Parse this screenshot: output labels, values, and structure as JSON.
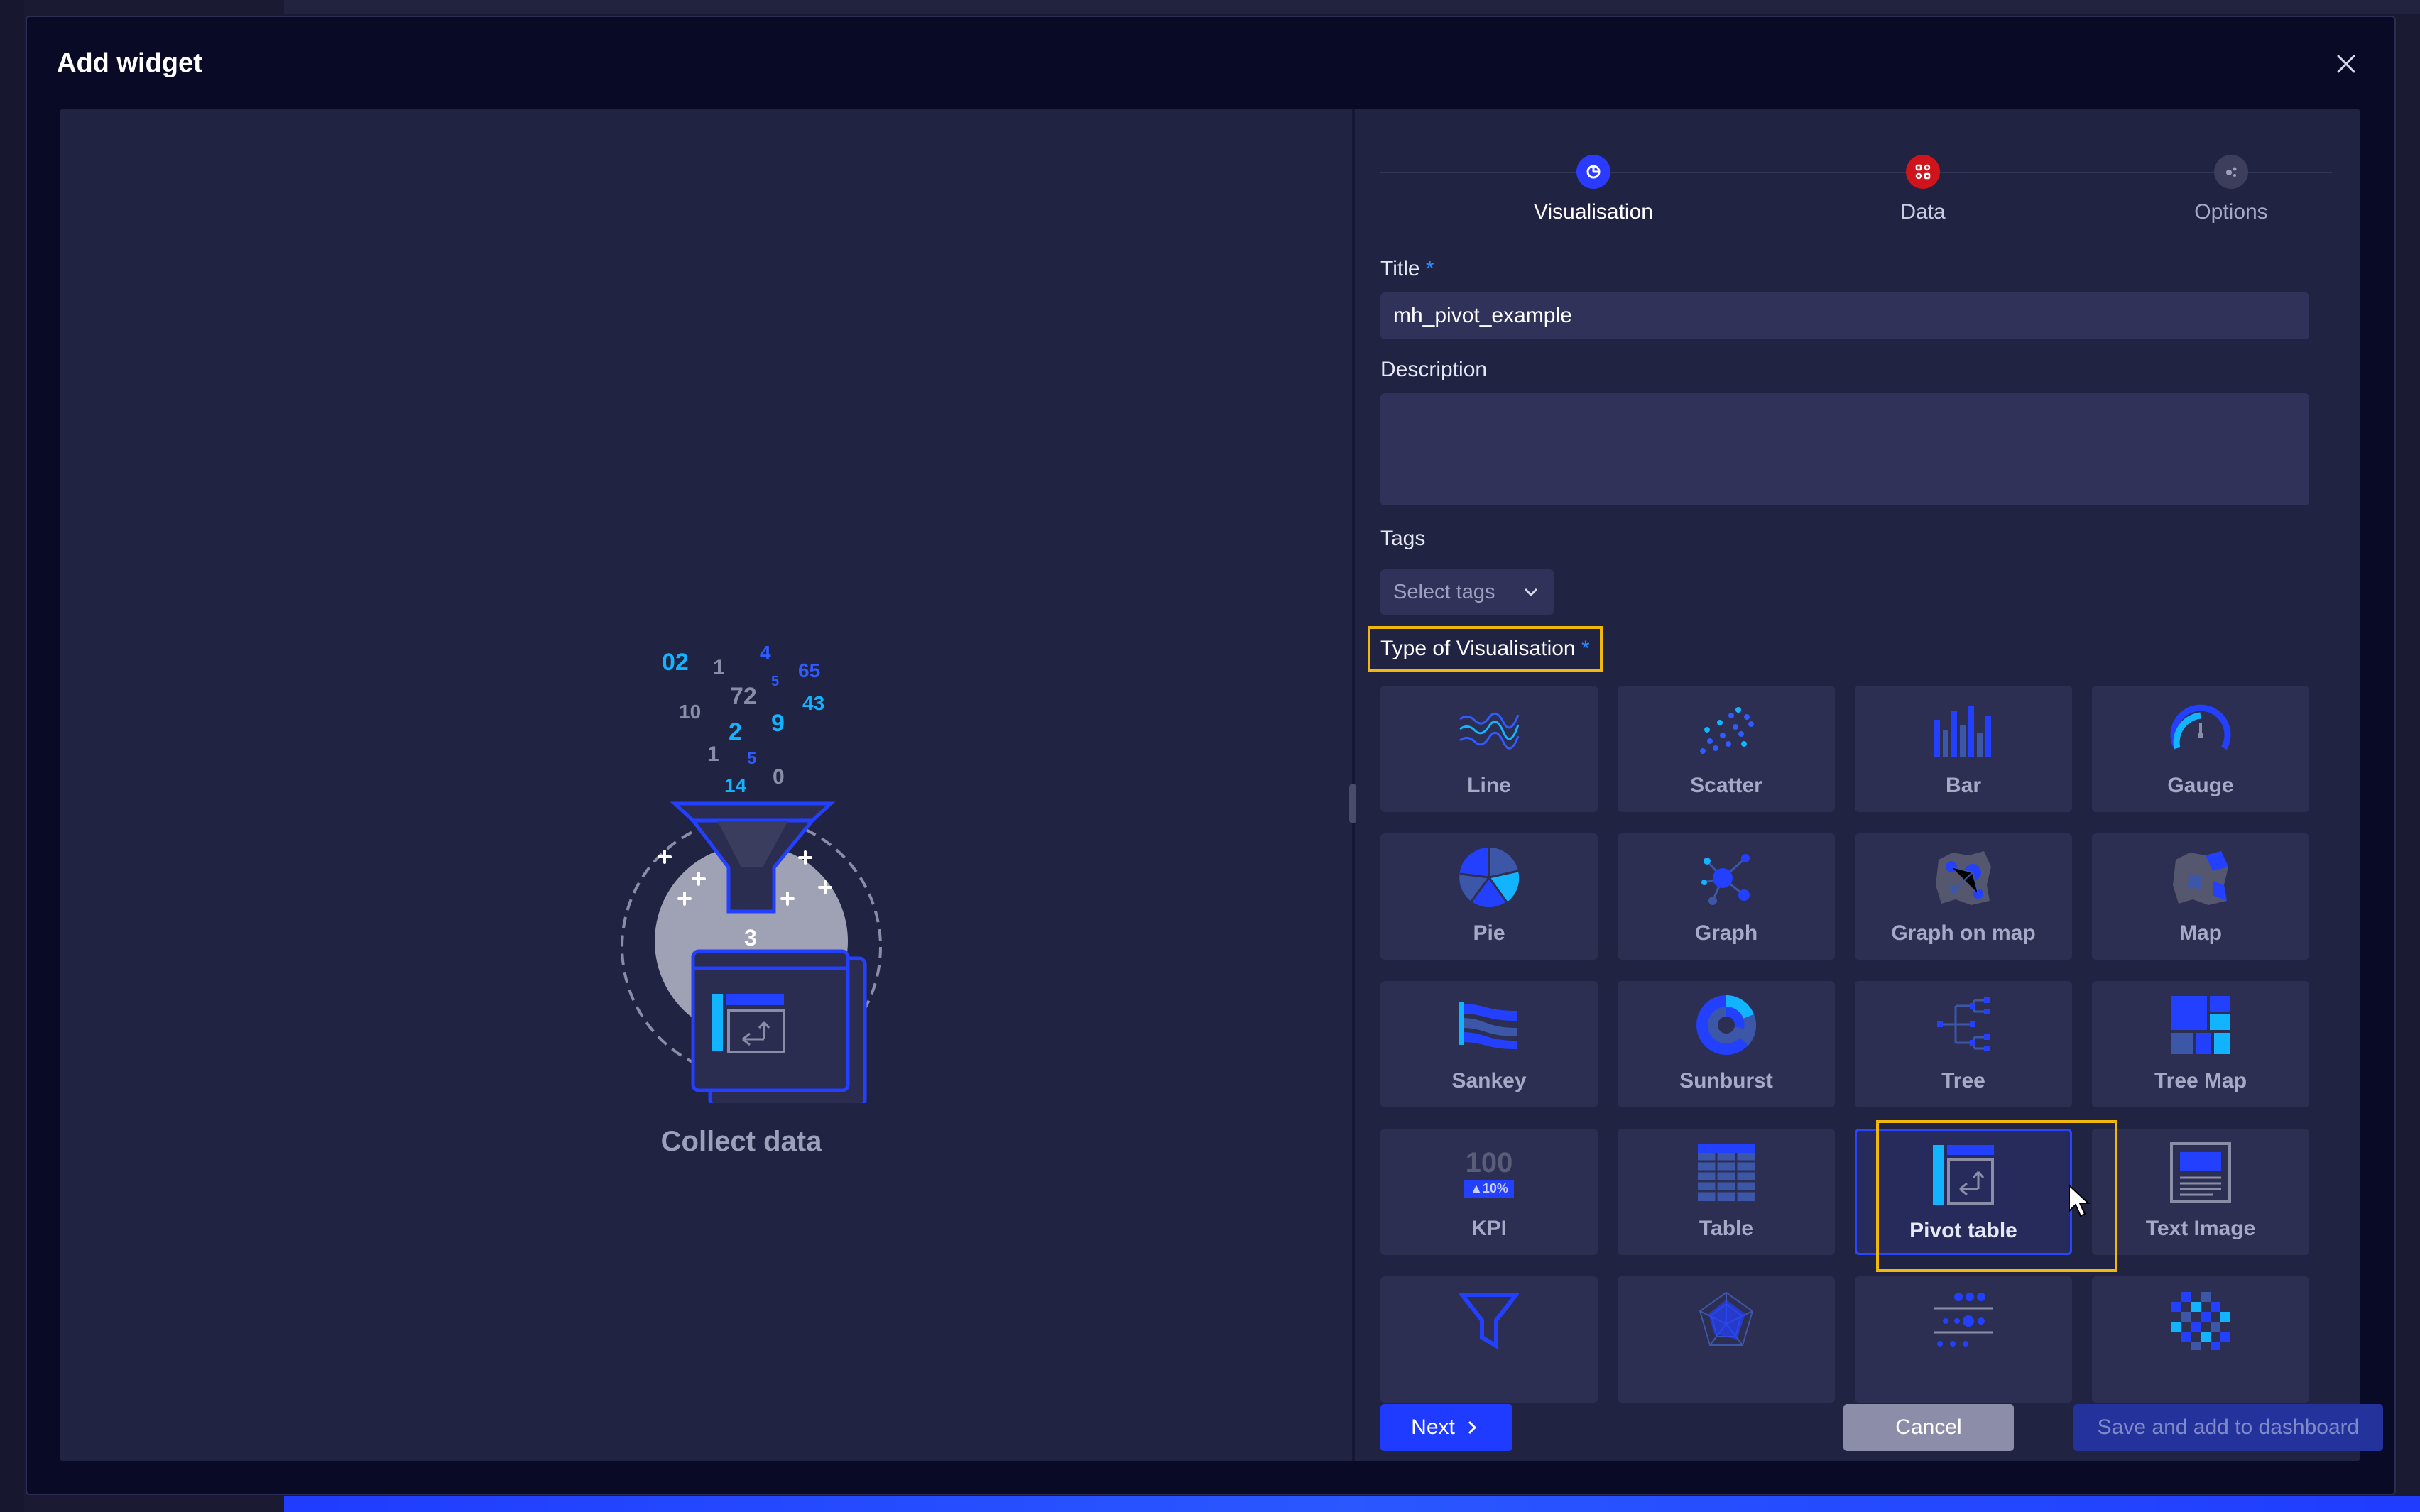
{
  "dialog": {
    "title": "Add widget"
  },
  "illustration": {
    "label": "Collect data",
    "numbers": [
      "02",
      "1",
      "4",
      "65",
      "10",
      "72",
      "5",
      "43",
      "2",
      "9",
      "1",
      "5",
      "14",
      "0",
      "3"
    ]
  },
  "stepper": {
    "steps": [
      {
        "label": "Visualisation",
        "icon": "chart-icon",
        "color": "#2a3bff",
        "active": true
      },
      {
        "label": "Data",
        "icon": "data-icon",
        "color": "#d0141c",
        "active": false
      },
      {
        "label": "Options",
        "icon": "options-icon",
        "color": "#3c3e5c",
        "active": false
      }
    ]
  },
  "form": {
    "title_label": "Title",
    "title_value": "mh_pivot_example",
    "description_label": "Description",
    "description_value": "",
    "tags_label": "Tags",
    "tags_placeholder": "Select tags",
    "type_label": "Type of Visualisation",
    "required_mark": "*"
  },
  "visualisations": [
    {
      "label": "Line",
      "icon": "line-chart-icon"
    },
    {
      "label": "Scatter",
      "icon": "scatter-chart-icon"
    },
    {
      "label": "Bar",
      "icon": "bar-chart-icon"
    },
    {
      "label": "Gauge",
      "icon": "gauge-icon"
    },
    {
      "label": "Pie",
      "icon": "pie-chart-icon"
    },
    {
      "label": "Graph",
      "icon": "graph-icon"
    },
    {
      "label": "Graph on map",
      "icon": "graph-on-map-icon"
    },
    {
      "label": "Map",
      "icon": "map-icon"
    },
    {
      "label": "Sankey",
      "icon": "sankey-icon"
    },
    {
      "label": "Sunburst",
      "icon": "sunburst-icon"
    },
    {
      "label": "Tree",
      "icon": "tree-icon"
    },
    {
      "label": "Tree Map",
      "icon": "tree-map-icon"
    },
    {
      "label": "KPI",
      "icon": "kpi-icon",
      "kpi_value": "100",
      "kpi_delta": "▲10%"
    },
    {
      "label": "Table",
      "icon": "table-icon"
    },
    {
      "label": "Pivot table",
      "icon": "pivot-table-icon",
      "selected": true
    },
    {
      "label": "Text Image",
      "icon": "text-image-icon"
    },
    {
      "label": "",
      "icon": "funnel-icon"
    },
    {
      "label": "",
      "icon": "radar-icon"
    },
    {
      "label": "",
      "icon": "dot-plot-icon"
    },
    {
      "label": "",
      "icon": "heatmap-icon"
    }
  ],
  "actions": {
    "next": "Next",
    "cancel": "Cancel",
    "save": "Save and add to dashboard"
  },
  "colors": {
    "accent": "#1e3bff",
    "highlight": "#f2b70c",
    "cyan": "#12b4ff"
  }
}
